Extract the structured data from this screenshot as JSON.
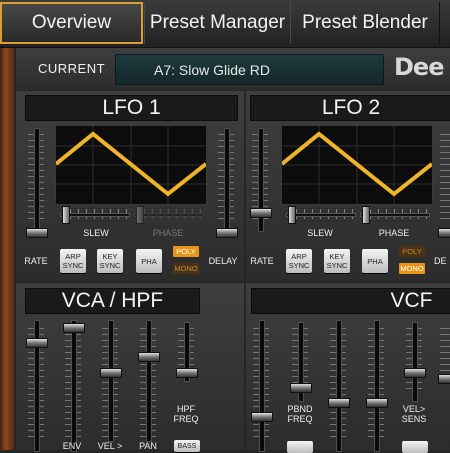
{
  "tabs": [
    {
      "label": "Overview",
      "active": true
    },
    {
      "label": "Preset Manager"
    },
    {
      "label": "Preset Blender"
    }
  ],
  "current": {
    "label": "CURRENT",
    "preset": "A7:  Slow Glide RD"
  },
  "logo": "Dee",
  "lfo1": {
    "title": "LFO 1",
    "slew": "SLEW",
    "phase": "PHASE",
    "rate": "RATE",
    "delay": "DELAY",
    "arp_sync": "ARP SYNC",
    "key_sync": "KEY SYNC",
    "pha": "PHA",
    "poly": "POLY",
    "mono": "MONO"
  },
  "lfo2": {
    "title": "LFO 2",
    "slew": "SLEW",
    "phase": "PHASE",
    "rate": "RATE",
    "delay": "DE",
    "arp_sync": "ARP SYNC",
    "key_sync": "KEY SYNC",
    "pha": "PHA",
    "poly": "POLY",
    "mono": "MONO"
  },
  "vca": {
    "title": "VCA / HPF",
    "hpf_freq": "HPF FREQ",
    "env": "ENV",
    "vel": "VEL >",
    "pan": "PAN",
    "bass": "BASS"
  },
  "vcf": {
    "title": "VCF",
    "pbnd_freq": "PBND FREQ",
    "vel_sens": "VEL> SENS"
  },
  "colors": {
    "accent": "#d8a030",
    "wave": "#f0b428",
    "poly_on": "#e89418",
    "display": "#1e3a3d"
  }
}
